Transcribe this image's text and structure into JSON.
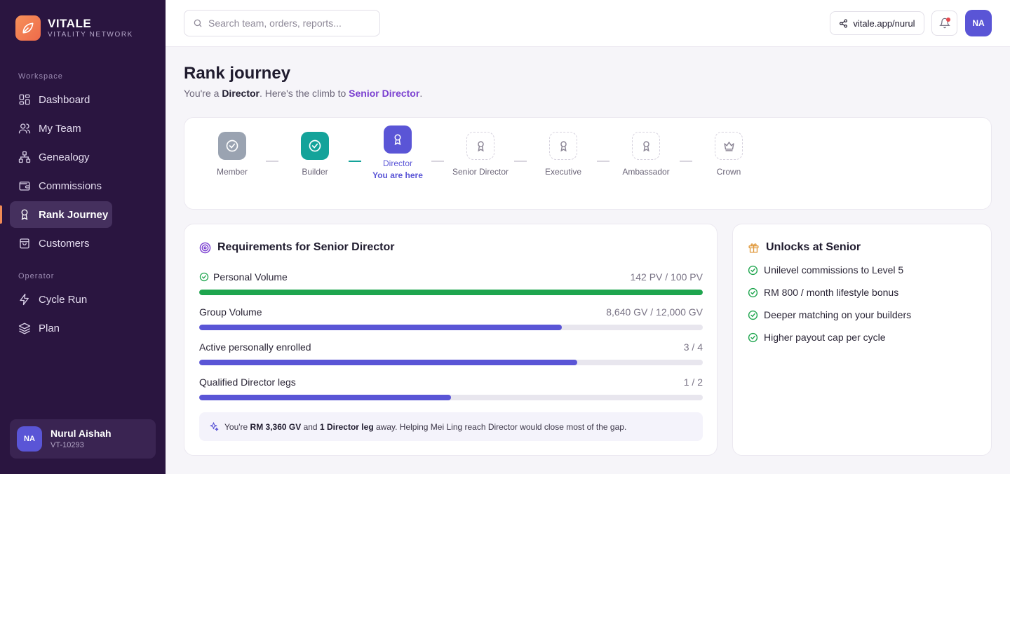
{
  "brand": {
    "name": "VITALE",
    "tagline": "VITALITY NETWORK"
  },
  "sidebar": {
    "sections": [
      {
        "label": "Workspace"
      },
      {
        "label": "Operator"
      }
    ],
    "items": [
      {
        "label": "Dashboard",
        "icon": "grid-icon"
      },
      {
        "label": "My Team",
        "icon": "users-icon"
      },
      {
        "label": "Genealogy",
        "icon": "tree-icon"
      },
      {
        "label": "Commissions",
        "icon": "wallet-icon"
      },
      {
        "label": "Rank Journey",
        "icon": "award-icon",
        "active": true
      },
      {
        "label": "Customers",
        "icon": "bag-icon"
      },
      {
        "label": "Cycle Run",
        "icon": "bolt-icon"
      },
      {
        "label": "Plan",
        "icon": "layers-icon"
      }
    ],
    "user": {
      "initials": "NA",
      "name": "Nurul Aishah",
      "id": "VT-10293"
    }
  },
  "topbar": {
    "search_placeholder": "Search team, orders, reports...",
    "share_link": "vitale.app/nurul",
    "avatar_initials": "NA"
  },
  "page": {
    "title": "Rank journey",
    "subtitle_prefix": "You're a ",
    "current_rank": "Director",
    "subtitle_middle": ". Here's the climb to ",
    "next_rank": "Senior Director",
    "subtitle_suffix": "."
  },
  "ranks": [
    {
      "label": "Member",
      "state": "done"
    },
    {
      "label": "Builder",
      "state": "done"
    },
    {
      "label": "Director",
      "state": "current",
      "note": "You are here"
    },
    {
      "label": "Senior Director",
      "state": "locked"
    },
    {
      "label": "Executive",
      "state": "locked"
    },
    {
      "label": "Ambassador",
      "state": "locked"
    },
    {
      "label": "Crown",
      "state": "locked"
    }
  ],
  "requirements": {
    "title": "Requirements for Senior Director",
    "items": [
      {
        "label": "Personal Volume",
        "value": "142 PV / 100 PV",
        "progress": 1.0,
        "met": true
      },
      {
        "label": "Group Volume",
        "value": "8,640 GV / 12,000 GV",
        "progress": 0.72,
        "met": false
      },
      {
        "label": "Active personally enrolled",
        "value": "3 / 4",
        "progress": 0.75,
        "met": false
      },
      {
        "label": "Qualified Director legs",
        "value": "1 / 2",
        "progress": 0.5,
        "met": false
      }
    ],
    "hint": {
      "prefix": "You're ",
      "gv_gap": "RM 3,360 GV",
      "middle": " and ",
      "leg_gap": "1 Director leg",
      "suffix": " away. Helping Mei Ling reach Director would close most of the gap."
    }
  },
  "unlocks": {
    "title": "Unlocks at Senior",
    "items": [
      "Unilevel commissions to Level 5",
      "RM 800 / month lifestyle bonus",
      "Deeper matching on your builders",
      "Higher payout cap per cycle"
    ]
  },
  "colors": {
    "sidebar_bg": "#2a1540",
    "accent": "#5a55d6",
    "teal": "#14a39a",
    "success": "#1ea54e",
    "brand_orange": "#f08a55"
  }
}
